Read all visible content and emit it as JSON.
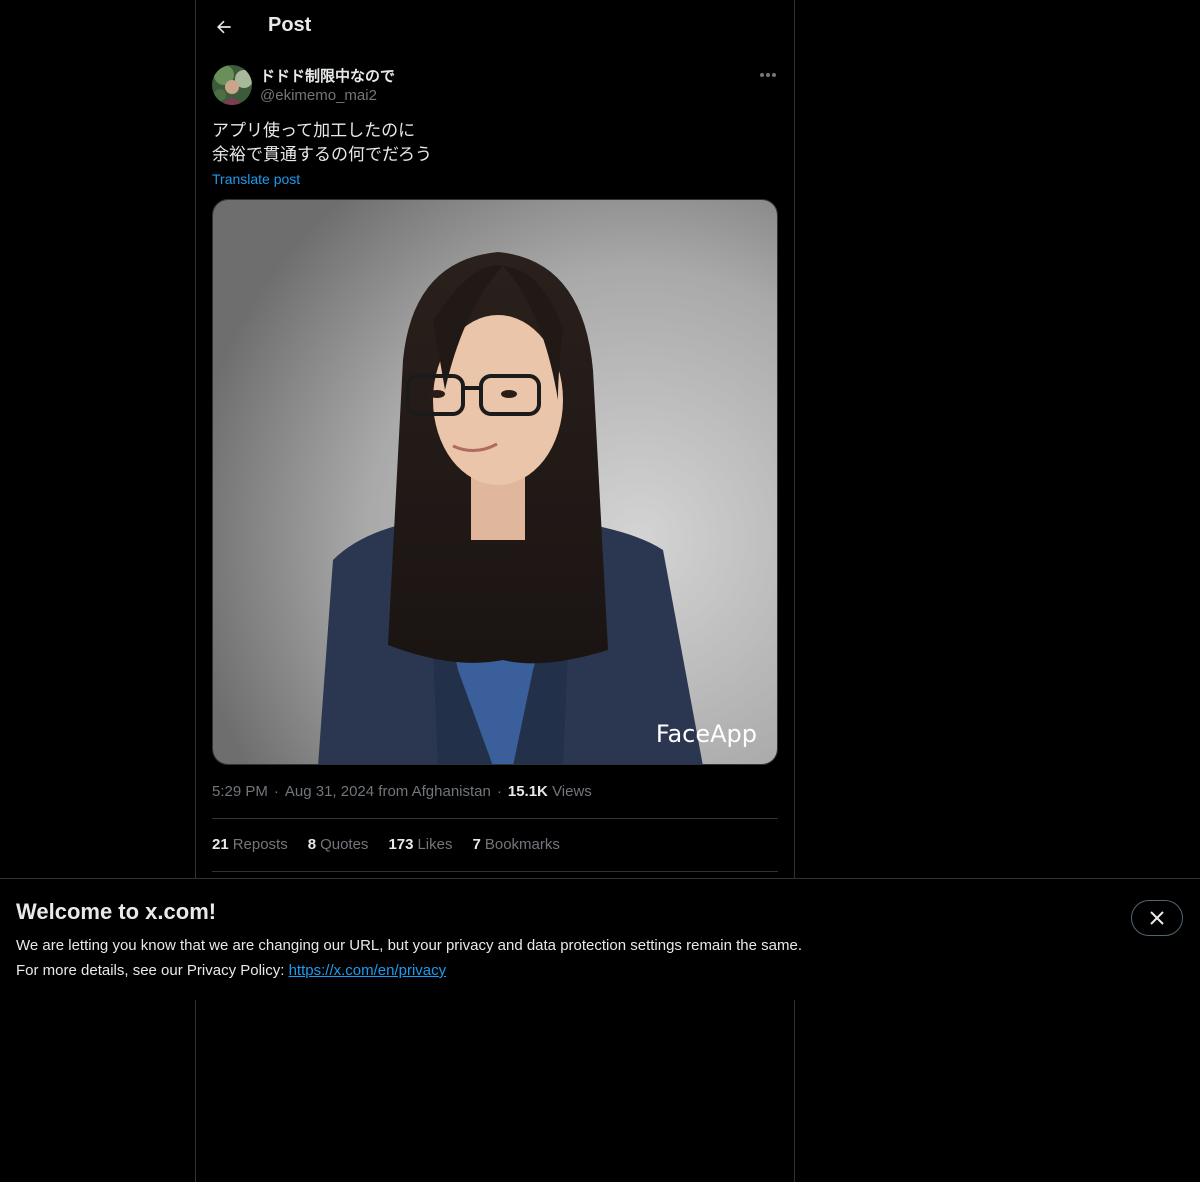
{
  "header": {
    "title": "Post",
    "back_icon": "arrow-left-icon"
  },
  "author": {
    "display_name": "ドドド制限中なので",
    "handle": "@ekimemo_mai2",
    "avatar_icon": "user-avatar"
  },
  "tweet": {
    "text_line1": "アプリ使って加工したのに",
    "text_line2": "余裕で貫通するの何でだろう",
    "translate_label": "Translate post",
    "media_watermark": "FaceApp"
  },
  "meta": {
    "time": "5:29 PM",
    "date": "Aug 31, 2024 from Afghanistan",
    "views_count": "15.1K",
    "views_label": "Views"
  },
  "stats": {
    "reposts_count": "21",
    "reposts_label": "Reposts",
    "quotes_count": "8",
    "quotes_label": "Quotes",
    "likes_count": "173",
    "likes_label": "Likes",
    "bookmarks_count": "7",
    "bookmarks_label": "Bookmarks"
  },
  "banner": {
    "title": "Welcome to x.com!",
    "line1": "We are letting you know that we are changing our URL, but your privacy and data protection settings remain the same.",
    "line2_prefix": "For more details, see our Privacy Policy: ",
    "link": "https://x.com/en/privacy",
    "close_icon": "close-icon"
  },
  "colors": {
    "background": "#000000",
    "text": "#e7e9ea",
    "muted": "#71767b",
    "accent": "#1d9bf0",
    "border": "#2f3336"
  }
}
